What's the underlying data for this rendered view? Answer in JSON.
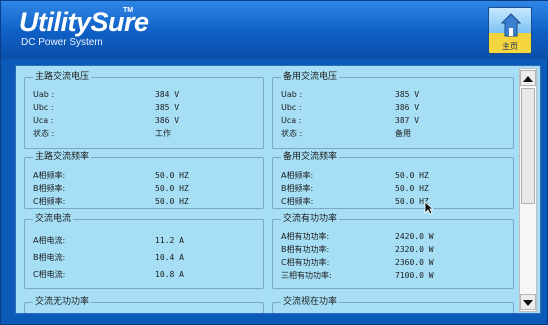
{
  "header": {
    "logo": "UtilitySure",
    "tm": "TM",
    "subtitle": "DC Power System",
    "home_label": "主页"
  },
  "panels": {
    "main_ac_voltage": {
      "title": "主路交流电压",
      "rows": [
        {
          "label": "Uab :",
          "value": "384 V"
        },
        {
          "label": "Ubc :",
          "value": "385 V"
        },
        {
          "label": "Uca :",
          "value": "386 V"
        },
        {
          "label": "状态 :",
          "value": "工作"
        }
      ]
    },
    "backup_ac_voltage": {
      "title": "备用交流电压",
      "rows": [
        {
          "label": "Uab :",
          "value": "385 V"
        },
        {
          "label": "Ubc :",
          "value": "386 V"
        },
        {
          "label": "Uca :",
          "value": "387 V"
        },
        {
          "label": "状态 :",
          "value": "备用"
        }
      ]
    },
    "main_ac_freq": {
      "title": "主路交流频率",
      "rows": [
        {
          "label": "A相频率:",
          "value": "50.0 HZ"
        },
        {
          "label": "B相频率:",
          "value": "50.0 HZ"
        },
        {
          "label": "C相频率:",
          "value": "50.0 HZ"
        }
      ]
    },
    "backup_ac_freq": {
      "title": "备用交流频率",
      "rows": [
        {
          "label": "A相频率:",
          "value": "50.0 HZ"
        },
        {
          "label": "B相频率:",
          "value": "50.0 HZ"
        },
        {
          "label": "C相频率:",
          "value": "50.0 HZ"
        }
      ]
    },
    "ac_current": {
      "title": "交流电流",
      "rows": [
        {
          "label": "A相电流:",
          "value": "11.2 A"
        },
        {
          "label": "B相电流:",
          "value": "10.4 A"
        },
        {
          "label": "C相电流:",
          "value": "10.8 A"
        }
      ]
    },
    "ac_active_power": {
      "title": "交流有功功率",
      "rows": [
        {
          "label": "A相有功功率:",
          "value": "2420.0 W"
        },
        {
          "label": "B相有功功率:",
          "value": "2320.0 W"
        },
        {
          "label": "C相有功功率:",
          "value": "2360.0 W"
        },
        {
          "label": "三相有功功率:",
          "value": "7100.0 W"
        }
      ]
    },
    "ac_reactive_power": {
      "title": "交流无功功率"
    },
    "ac_apparent_power": {
      "title": "交流视在功率"
    }
  },
  "icons": {
    "home": "home-icon",
    "scroll_up": "arrow-up-icon",
    "scroll_down": "arrow-down-icon",
    "cursor": "mouse-pointer-icon"
  },
  "colors": {
    "app_background": "#0c5ab8",
    "content_background": "#a6dff5",
    "home_accent": "#f6d842"
  }
}
